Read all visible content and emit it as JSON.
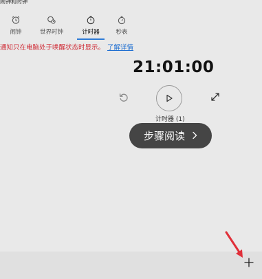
{
  "app": {
    "title": "闹钟和时钟"
  },
  "tabs": [
    {
      "label": "闹钟",
      "icon": "alarm-icon"
    },
    {
      "label": "世界时钟",
      "icon": "world-clock-icon"
    },
    {
      "label": "计时器",
      "icon": "timer-icon",
      "active": true
    },
    {
      "label": "秒表",
      "icon": "stopwatch-icon"
    }
  ],
  "notice": {
    "text": "通知只在电脑处于唤醒状态时显示。",
    "link": "了解详情"
  },
  "timer": {
    "time": "21:01:00",
    "name": "计时器 (1)"
  },
  "overlay": {
    "label": "步骤阅读"
  },
  "colors": {
    "accent": "#2c7ad6",
    "notice": "#d0303a",
    "link": "#1f6fd1",
    "arrow": "#e0303a"
  }
}
